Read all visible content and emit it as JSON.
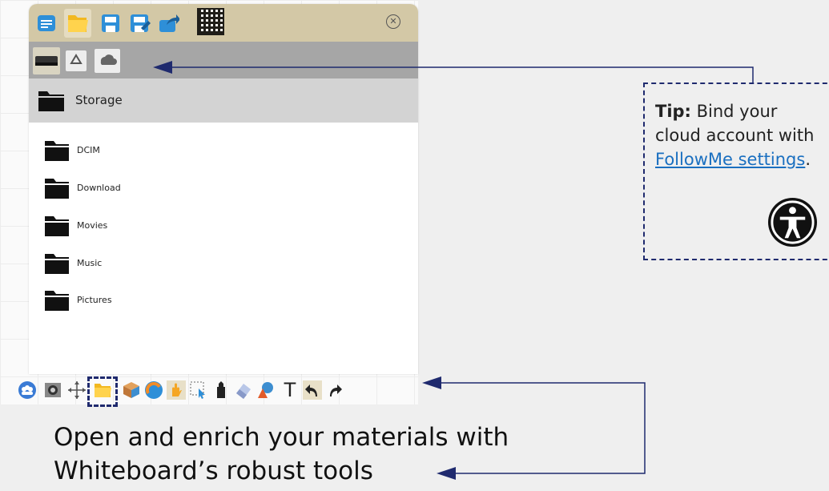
{
  "dialog": {
    "toolbar_icons": [
      "new-document-icon",
      "open-folder-icon",
      "save-icon",
      "save-as-icon",
      "share-icon",
      "qr-code-icon",
      "close-icon"
    ],
    "close_glyph": "✕",
    "storage_tabs": [
      "local-storage-icon",
      "google-drive-icon",
      "onedrive-icon"
    ],
    "storage_header": "Storage",
    "folders": [
      "DCIM",
      "Download",
      "Movies",
      "Music",
      "Pictures"
    ]
  },
  "bottom_toolbar": {
    "icons": [
      "users-icon",
      "camera-icon",
      "move-icon",
      "folder-icon",
      "box-icon",
      "browser-icon",
      "hand-icon",
      "select-icon",
      "marker-icon",
      "eraser-icon",
      "shapes-icon",
      "text-icon",
      "undo-icon",
      "redo-icon"
    ],
    "text_tool_glyph": "T"
  },
  "tip": {
    "bold": "Tip:",
    "text": " Bind your cloud account with ",
    "link": "FollowMe settings",
    "end": "."
  },
  "caption": {
    "line1": "Open and enrich your materials with",
    "line2": "Whiteboard’s robust tools"
  },
  "colors": {
    "toolbar_bg": "#d3c8a6",
    "tabs_bg": "#a6a6a6",
    "header_bg": "#d3d3d3",
    "annotation": "#1f2a6e",
    "link": "#1a6fc0"
  }
}
